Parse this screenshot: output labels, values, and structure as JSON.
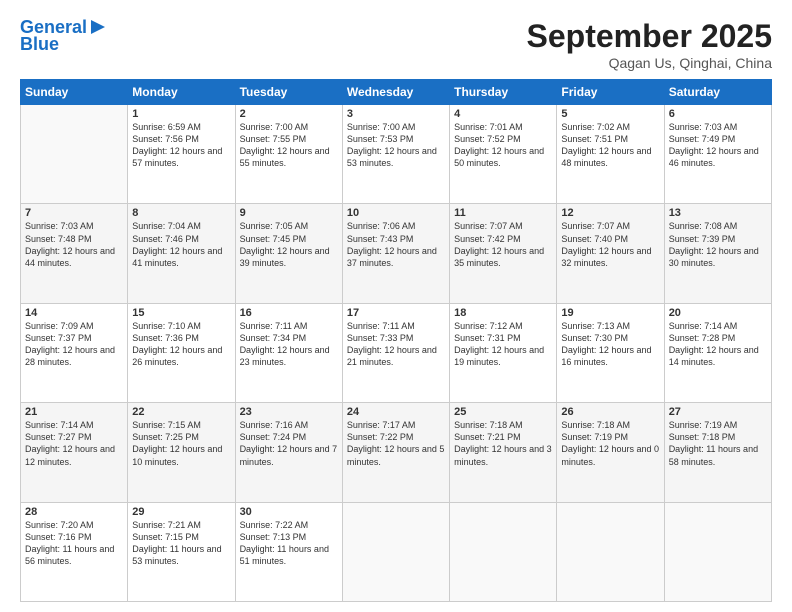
{
  "logo": {
    "line1": "General",
    "line2": "Blue"
  },
  "header": {
    "month": "September 2025",
    "location": "Qagan Us, Qinghai, China"
  },
  "weekdays": [
    "Sunday",
    "Monday",
    "Tuesday",
    "Wednesday",
    "Thursday",
    "Friday",
    "Saturday"
  ],
  "weeks": [
    [
      {
        "day": null,
        "sunrise": null,
        "sunset": null,
        "daylight": null
      },
      {
        "day": "1",
        "sunrise": "Sunrise: 6:59 AM",
        "sunset": "Sunset: 7:56 PM",
        "daylight": "Daylight: 12 hours and 57 minutes."
      },
      {
        "day": "2",
        "sunrise": "Sunrise: 7:00 AM",
        "sunset": "Sunset: 7:55 PM",
        "daylight": "Daylight: 12 hours and 55 minutes."
      },
      {
        "day": "3",
        "sunrise": "Sunrise: 7:00 AM",
        "sunset": "Sunset: 7:53 PM",
        "daylight": "Daylight: 12 hours and 53 minutes."
      },
      {
        "day": "4",
        "sunrise": "Sunrise: 7:01 AM",
        "sunset": "Sunset: 7:52 PM",
        "daylight": "Daylight: 12 hours and 50 minutes."
      },
      {
        "day": "5",
        "sunrise": "Sunrise: 7:02 AM",
        "sunset": "Sunset: 7:51 PM",
        "daylight": "Daylight: 12 hours and 48 minutes."
      },
      {
        "day": "6",
        "sunrise": "Sunrise: 7:03 AM",
        "sunset": "Sunset: 7:49 PM",
        "daylight": "Daylight: 12 hours and 46 minutes."
      }
    ],
    [
      {
        "day": "7",
        "sunrise": "Sunrise: 7:03 AM",
        "sunset": "Sunset: 7:48 PM",
        "daylight": "Daylight: 12 hours and 44 minutes."
      },
      {
        "day": "8",
        "sunrise": "Sunrise: 7:04 AM",
        "sunset": "Sunset: 7:46 PM",
        "daylight": "Daylight: 12 hours and 41 minutes."
      },
      {
        "day": "9",
        "sunrise": "Sunrise: 7:05 AM",
        "sunset": "Sunset: 7:45 PM",
        "daylight": "Daylight: 12 hours and 39 minutes."
      },
      {
        "day": "10",
        "sunrise": "Sunrise: 7:06 AM",
        "sunset": "Sunset: 7:43 PM",
        "daylight": "Daylight: 12 hours and 37 minutes."
      },
      {
        "day": "11",
        "sunrise": "Sunrise: 7:07 AM",
        "sunset": "Sunset: 7:42 PM",
        "daylight": "Daylight: 12 hours and 35 minutes."
      },
      {
        "day": "12",
        "sunrise": "Sunrise: 7:07 AM",
        "sunset": "Sunset: 7:40 PM",
        "daylight": "Daylight: 12 hours and 32 minutes."
      },
      {
        "day": "13",
        "sunrise": "Sunrise: 7:08 AM",
        "sunset": "Sunset: 7:39 PM",
        "daylight": "Daylight: 12 hours and 30 minutes."
      }
    ],
    [
      {
        "day": "14",
        "sunrise": "Sunrise: 7:09 AM",
        "sunset": "Sunset: 7:37 PM",
        "daylight": "Daylight: 12 hours and 28 minutes."
      },
      {
        "day": "15",
        "sunrise": "Sunrise: 7:10 AM",
        "sunset": "Sunset: 7:36 PM",
        "daylight": "Daylight: 12 hours and 26 minutes."
      },
      {
        "day": "16",
        "sunrise": "Sunrise: 7:11 AM",
        "sunset": "Sunset: 7:34 PM",
        "daylight": "Daylight: 12 hours and 23 minutes."
      },
      {
        "day": "17",
        "sunrise": "Sunrise: 7:11 AM",
        "sunset": "Sunset: 7:33 PM",
        "daylight": "Daylight: 12 hours and 21 minutes."
      },
      {
        "day": "18",
        "sunrise": "Sunrise: 7:12 AM",
        "sunset": "Sunset: 7:31 PM",
        "daylight": "Daylight: 12 hours and 19 minutes."
      },
      {
        "day": "19",
        "sunrise": "Sunrise: 7:13 AM",
        "sunset": "Sunset: 7:30 PM",
        "daylight": "Daylight: 12 hours and 16 minutes."
      },
      {
        "day": "20",
        "sunrise": "Sunrise: 7:14 AM",
        "sunset": "Sunset: 7:28 PM",
        "daylight": "Daylight: 12 hours and 14 minutes."
      }
    ],
    [
      {
        "day": "21",
        "sunrise": "Sunrise: 7:14 AM",
        "sunset": "Sunset: 7:27 PM",
        "daylight": "Daylight: 12 hours and 12 minutes."
      },
      {
        "day": "22",
        "sunrise": "Sunrise: 7:15 AM",
        "sunset": "Sunset: 7:25 PM",
        "daylight": "Daylight: 12 hours and 10 minutes."
      },
      {
        "day": "23",
        "sunrise": "Sunrise: 7:16 AM",
        "sunset": "Sunset: 7:24 PM",
        "daylight": "Daylight: 12 hours and 7 minutes."
      },
      {
        "day": "24",
        "sunrise": "Sunrise: 7:17 AM",
        "sunset": "Sunset: 7:22 PM",
        "daylight": "Daylight: 12 hours and 5 minutes."
      },
      {
        "day": "25",
        "sunrise": "Sunrise: 7:18 AM",
        "sunset": "Sunset: 7:21 PM",
        "daylight": "Daylight: 12 hours and 3 minutes."
      },
      {
        "day": "26",
        "sunrise": "Sunrise: 7:18 AM",
        "sunset": "Sunset: 7:19 PM",
        "daylight": "Daylight: 12 hours and 0 minutes."
      },
      {
        "day": "27",
        "sunrise": "Sunrise: 7:19 AM",
        "sunset": "Sunset: 7:18 PM",
        "daylight": "Daylight: 11 hours and 58 minutes."
      }
    ],
    [
      {
        "day": "28",
        "sunrise": "Sunrise: 7:20 AM",
        "sunset": "Sunset: 7:16 PM",
        "daylight": "Daylight: 11 hours and 56 minutes."
      },
      {
        "day": "29",
        "sunrise": "Sunrise: 7:21 AM",
        "sunset": "Sunset: 7:15 PM",
        "daylight": "Daylight: 11 hours and 53 minutes."
      },
      {
        "day": "30",
        "sunrise": "Sunrise: 7:22 AM",
        "sunset": "Sunset: 7:13 PM",
        "daylight": "Daylight: 11 hours and 51 minutes."
      },
      {
        "day": null,
        "sunrise": null,
        "sunset": null,
        "daylight": null
      },
      {
        "day": null,
        "sunrise": null,
        "sunset": null,
        "daylight": null
      },
      {
        "day": null,
        "sunrise": null,
        "sunset": null,
        "daylight": null
      },
      {
        "day": null,
        "sunrise": null,
        "sunset": null,
        "daylight": null
      }
    ]
  ]
}
